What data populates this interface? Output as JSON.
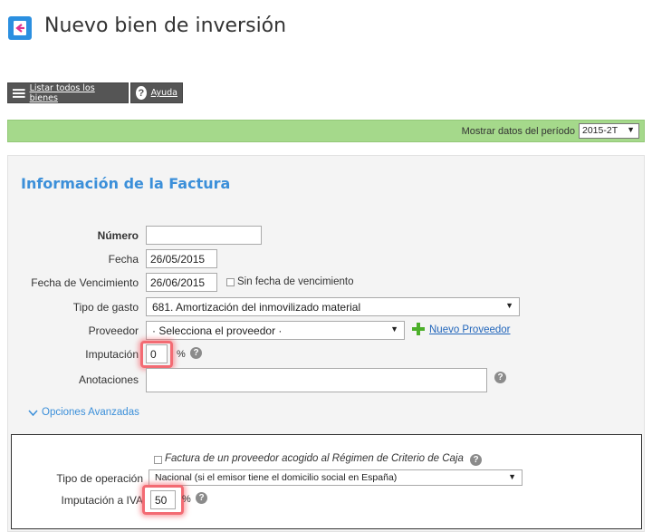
{
  "header": {
    "title": "Nuevo bien de inversión"
  },
  "toolbar": {
    "list_label": "Listar todos los bienes",
    "help_label": "Ayuda"
  },
  "period": {
    "label": "Mostrar datos del período",
    "value": "2015-2T"
  },
  "section": {
    "title": "Información de la Factura"
  },
  "form": {
    "numero_label": "Número",
    "numero_value": "",
    "fecha_label": "Fecha",
    "fecha_value": "26/05/2015",
    "venc_label": "Fecha de Vencimiento",
    "venc_value": "26/06/2015",
    "sin_fecha_label": "Sin fecha de vencimiento",
    "tipo_gasto_label": "Tipo de gasto",
    "tipo_gasto_value": "681. Amortización del inmovilizado material",
    "proveedor_label": "Proveedor",
    "proveedor_value": "· Selecciona el proveedor ·",
    "nuevo_proveedor": "Nuevo Proveedor",
    "imputacion_label": "Imputación",
    "imputacion_value": "0",
    "percent": "%",
    "anotaciones_label": "Anotaciones",
    "anotaciones_value": ""
  },
  "advanced": {
    "toggle_label": "Opciones Avanzadas",
    "criterio_caja_label": "Factura de un proveedor acogido al Régimen de Criterio de Caja",
    "tipo_operacion_label": "Tipo de operación",
    "tipo_operacion_value": "Nacional (si el emisor tiene el domicilio social en España)",
    "imputacion_iva_label": "Imputación a IVA",
    "imputacion_iva_value": "50",
    "percent": "%"
  },
  "colors": {
    "accent": "#3b8fd9",
    "period_bar": "#a5d98b",
    "highlight": "#f36b73",
    "add_icon": "#4caf2a"
  }
}
